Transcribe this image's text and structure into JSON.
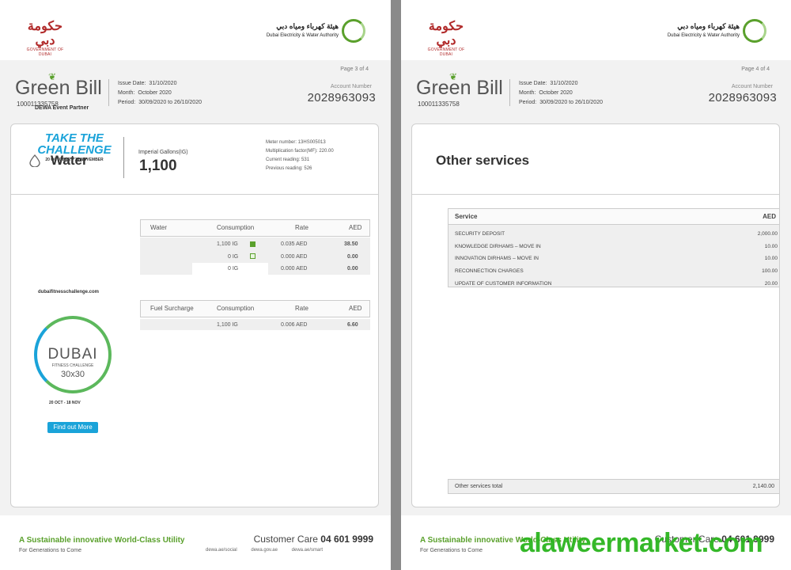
{
  "header": {
    "gov_logo_script": "حكومة دبي",
    "gov_logo_sub": "GOVERNMENT OF DUBAI",
    "dewa_logo_ar": "هيئة كهرباء ومياه دبي",
    "dewa_logo_en": "Dubai Electricity & Water Authority",
    "bill_title": "Green Bill",
    "bill_number": "100011335758",
    "issue_date_label": "Issue Date:",
    "issue_date": "31/10/2020",
    "month_label": "Month:",
    "month": "October 2020",
    "period_label": "Period:",
    "period": "30/09/2020 to 26/10/2020",
    "account_label": "Account Number",
    "account_number": "2028963093"
  },
  "pages": {
    "left_page_no": "Page 3 of 4",
    "right_page_no": "Page 4 of 4"
  },
  "water": {
    "title": "Water",
    "ig_label": "Imperial Gallons(IG)",
    "ig_value": "1,100",
    "meter_number": "Meter number: 13HS005013",
    "multiplication": "Multiplication factor(MF): 220.00",
    "current_reading": "Current reading: 531",
    "previous_reading": "Previous reading: 526"
  },
  "sponsor": {
    "partner": "DEWA Event Partner",
    "take_line1": "TAKE THE",
    "take_line2": "CHALLENGE",
    "take_dates": "20 OCTOBER – 18 NOVEMBER",
    "url": "dubaifitnesschallenge.com",
    "dubai": "DUBAI",
    "fitness": "FITNESS CHALLENGE",
    "thirty": "30x30",
    "dates": "20 OCT - 18 NOV",
    "find_more": "Find out More"
  },
  "water_table": {
    "headers": [
      "Water",
      "Consumption",
      "Rate",
      "AED"
    ],
    "rows": [
      {
        "consumption": "1,100 IG",
        "rate": "0.035 AED",
        "aed": "38.50",
        "checked": true
      },
      {
        "consumption": "0 IG",
        "rate": "0.000 AED",
        "aed": "0.00",
        "checked": false
      },
      {
        "consumption": "0 IG",
        "rate": "0.000 AED",
        "aed": "0.00",
        "checked": false
      }
    ]
  },
  "fuel_table": {
    "headers": [
      "Fuel Surcharge",
      "Consumption",
      "Rate",
      "AED"
    ],
    "rows": [
      {
        "consumption": "1,100 IG",
        "rate": "0.006 AED",
        "aed": "6.60"
      }
    ]
  },
  "other": {
    "title": "Other services",
    "service_header": "Service",
    "aed_header": "AED",
    "items": [
      {
        "name": "SECURITY DEPOSIT",
        "aed": "2,000.00"
      },
      {
        "name": "KNOWLEDGE DIRHAMS – MOVE IN",
        "aed": "10.00"
      },
      {
        "name": "INNOVATION DIRHAMS – MOVE IN",
        "aed": "10.00"
      },
      {
        "name": "RECONNECTION CHARGES",
        "aed": "100.00"
      },
      {
        "name": "UPDATE OF CUSTOMER INFORMATION",
        "aed": "20.00"
      }
    ],
    "total_label": "Other services total",
    "total_value": "2,140.00"
  },
  "footer": {
    "tagline": "A Sustainable innovative World-Class Utility",
    "tagline2": "For Generations to Come",
    "cc_label": "Customer Care",
    "cc_number": "04 601 9999",
    "link_social": "dewa.ae/social",
    "link_gov": "dewa.gov.ae",
    "link_smart": "dewa.ae/smart"
  },
  "watermark": "alaweermarket.com",
  "colors": {
    "green": "#5aa02c",
    "blue": "#1aa3d9",
    "brand_red": "#b12a2a"
  }
}
